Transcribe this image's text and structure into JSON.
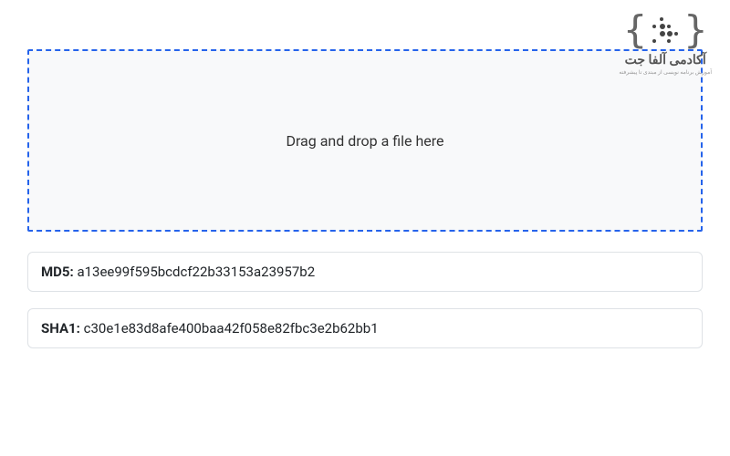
{
  "logo": {
    "title": "آکادمی آلفا جت",
    "subtitle": "آموزش برنامه نویسی از مبتدی تا پیشرفته"
  },
  "dropzone": {
    "text": "Drag and drop a file here"
  },
  "hashes": [
    {
      "label": "MD5:",
      "value": "a13ee99f595bcdcf22b33153a23957b2"
    },
    {
      "label": "SHA1:",
      "value": "c30e1e83d8afe400baa42f058e82fbc3e2b62bb1"
    }
  ]
}
